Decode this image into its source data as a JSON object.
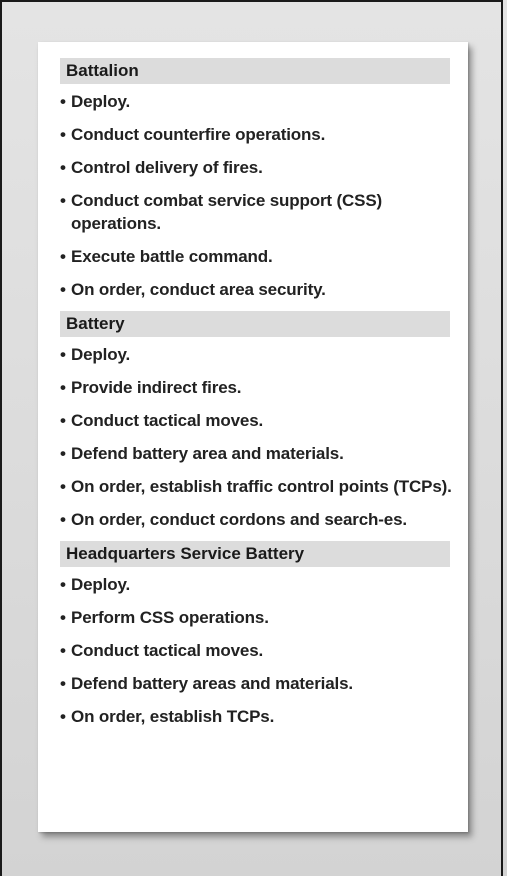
{
  "sections": [
    {
      "title": "Battalion",
      "items": [
        "Deploy.",
        "Conduct counterfire operations.",
        "Control delivery of fires.",
        "Conduct combat service support (CSS) operations.",
        "Execute battle command.",
        "On order, conduct area security."
      ]
    },
    {
      "title": "Battery",
      "items": [
        "Deploy.",
        "Provide indirect fires.",
        "Conduct tactical moves.",
        "Defend battery area and materials.",
        "On order, establish traffic control points (TCPs).",
        "On order, conduct cordons and search-es."
      ]
    },
    {
      "title": "Headquarters Service Battery",
      "items": [
        "Deploy.",
        "Perform CSS operations.",
        "Conduct tactical moves.",
        "Defend battery areas and materials.",
        "On order, establish TCPs."
      ]
    }
  ]
}
